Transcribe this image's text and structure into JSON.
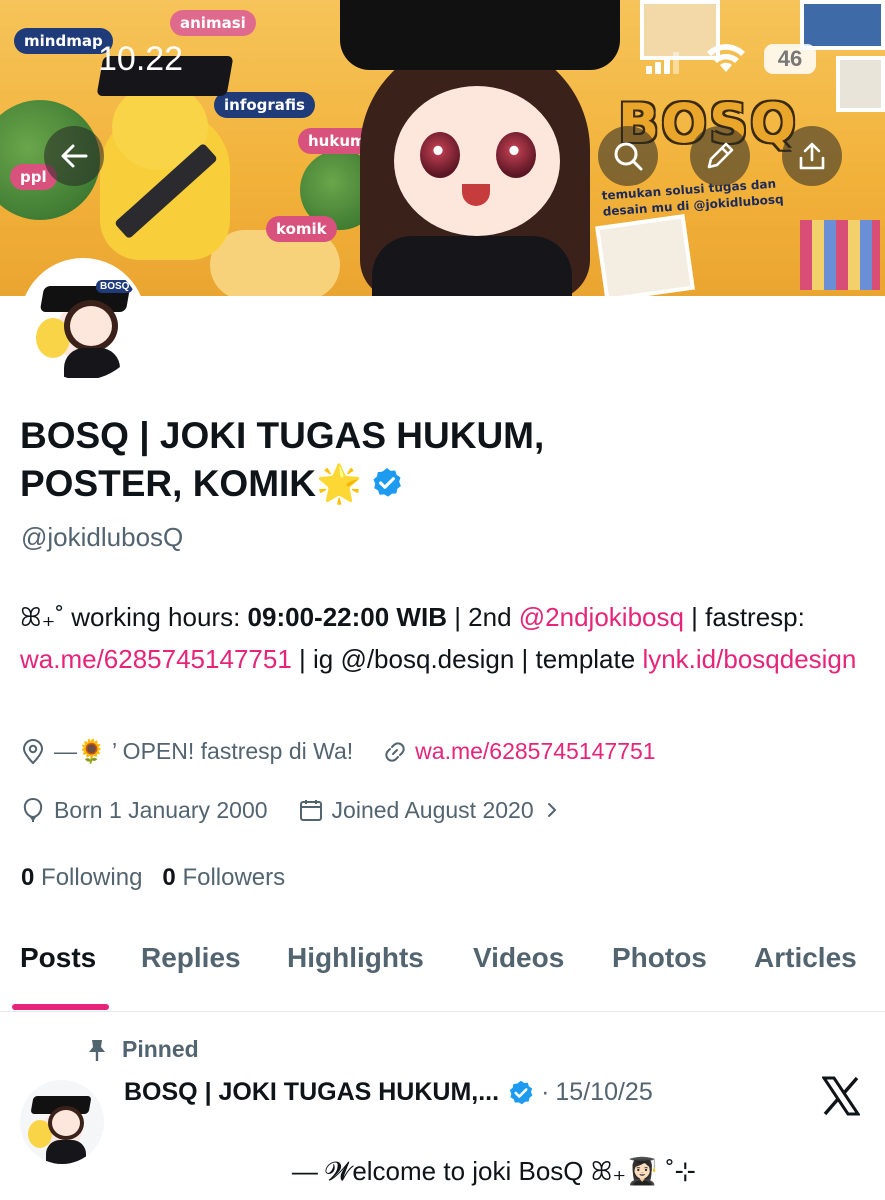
{
  "status_bar": {
    "time": "10.22",
    "battery": "46"
  },
  "banner": {
    "tags": {
      "mindmap": "mindmap",
      "animasi": "animasi",
      "infografis": "infografis",
      "hukum": "hukum",
      "ppl": "ppl",
      "komik": "komik"
    },
    "brand": "BOSQ",
    "brand_subtitle": "temukan solusi tugas dan desain mu di @jokidlubosq"
  },
  "nav_icons": {
    "back": "arrow-left-icon",
    "search": "search-icon",
    "edit": "pencil-icon",
    "share": "share-icon"
  },
  "profile": {
    "name": "BOSQ | JOKI TUGAS HUKUM, POSTER, KOMIK🌟",
    "handle": "@jokidlubosQ",
    "bio": {
      "prefix": "ꕤ₊˚ working hours: ",
      "hours": "09:00-22:00 WIB",
      "mid1": " | 2nd ",
      "second_account": "@2ndjokibosq",
      "mid2": " | fastresp: ",
      "fastresp_link": "wa.me/6285745147751",
      "mid3": " | ig @/bosq.design | template ",
      "template_link": "lynk.id/bosqdesign"
    },
    "location": "—🌻 ’ OPEN! fastresp di Wa!",
    "website": "wa.me/6285745147751",
    "born": "Born 1 January 2000",
    "joined": "Joined August 2020",
    "following_count": "0",
    "following_label": "Following",
    "followers_count": "0",
    "followers_label": "Followers"
  },
  "tabs": [
    "Posts",
    "Replies",
    "Highlights",
    "Videos",
    "Photos",
    "Articles"
  ],
  "active_tab": "Posts",
  "pinned_tweet": {
    "pinned_label": "Pinned",
    "author_name": "BOSQ | JOKI TUGAS HUKUM,...",
    "separator": "·",
    "date": "15/10/25",
    "text": "— 𝓦elcome to joki BosQ ꕤ₊👩🏻‍🎓 ˚⊹"
  },
  "colors": {
    "accent": "#e6247a",
    "verified": "#1d9bf0",
    "secondary_text": "#536471",
    "primary_text": "#0f1419"
  }
}
